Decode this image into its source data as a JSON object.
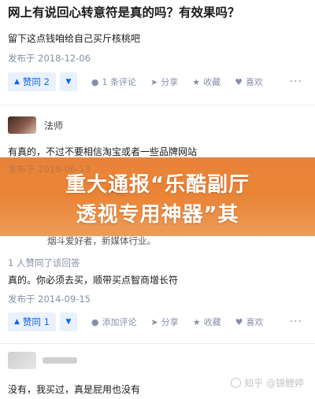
{
  "question": {
    "title": "网上有说回心转意符是真的吗？有效果吗？"
  },
  "answers": [
    {
      "text": "留下这点钱咱给自己买斤核桃吧",
      "date": "发布于 2018-12-06",
      "vote_label": "赞同 2",
      "comment_label": "1 条评论",
      "share_label": "分享",
      "collect_label": "收藏",
      "like_label": "喜欢",
      "more_label": "···"
    },
    {
      "author": "法师",
      "text": "有真的，不过不要相信淘宝或者一些品牌网站",
      "date_partial": "发布于 2019-06-13",
      "comment_partial": "评论"
    },
    {
      "author_bio_partial": "烟斗爱好者，新媒体行业。",
      "vote_note": "1 人赞同了该回答",
      "text": "真的。你必须去买，顺带买点智商增长符",
      "date": "发布于 2014-09-15",
      "vote_label": "赞同 1",
      "comment_label": "添加评论",
      "share_label": "分享",
      "collect_label": "收藏",
      "like_label": "喜欢",
      "more_label": "···"
    },
    {
      "text": "没有，我买过，真是屁用也没有"
    }
  ],
  "banner": {
    "line1": "重大通报“乐酷副厅",
    "line2": "透视专用神器”其"
  },
  "watermark": "知乎 @锦鲤婷",
  "colors": {
    "accent": "#0f66ea",
    "accent_bg": "#e8f1fd",
    "meta": "#8590a6",
    "banner": "#e77828"
  },
  "icons": {
    "vote_up": "triangle-up-icon",
    "vote_down": "triangle-down-icon",
    "comment": "comment-bubble-icon",
    "share": "share-plane-icon",
    "collect": "star-icon",
    "like": "heart-icon"
  }
}
